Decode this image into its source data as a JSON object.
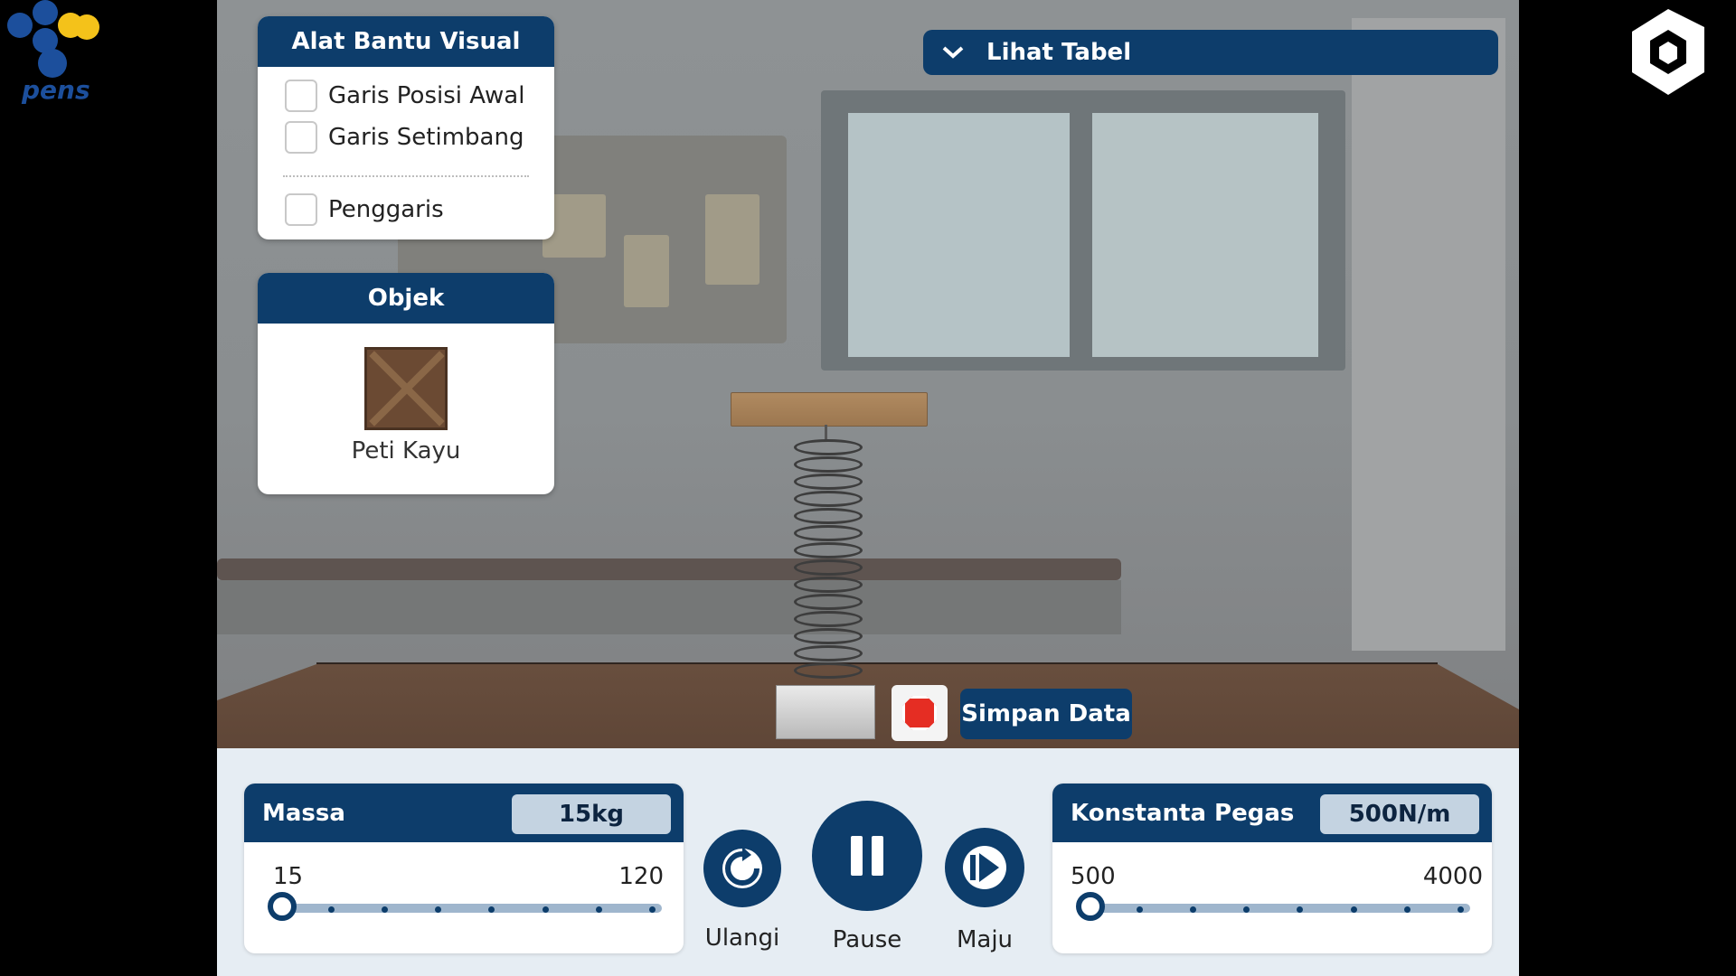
{
  "logos": {
    "left_text": "pens",
    "left_icon": "pens-logo-icon",
    "right_icon": "brand-logo-icon"
  },
  "colors": {
    "primary": "#0d3d6b",
    "slider_track": "#9fb6cd",
    "value_box": "#c4d3e1",
    "stop": "#e52d23"
  },
  "visual_aids": {
    "title": "Alat Bantu Visual",
    "options": [
      {
        "label": "Garis Posisi Awal",
        "checked": false
      },
      {
        "label": "Garis Setimbang",
        "checked": false
      },
      {
        "label": "Penggaris",
        "checked": false
      }
    ]
  },
  "object_panel": {
    "title": "Objek",
    "item_label": "Peti Kayu",
    "item_icon": "wooden-crate-icon"
  },
  "table_toggle": {
    "label": "Lihat Tabel",
    "icon": "chevron-down-icon"
  },
  "save_button": {
    "label": "Simpan Data"
  },
  "stop_button": {
    "icon": "stop-icon"
  },
  "mass": {
    "title": "Massa",
    "value": "15kg",
    "min": "15",
    "max": "120",
    "current": 15
  },
  "spring_constant": {
    "title": "Konstanta Pegas",
    "value": "500N/m",
    "min": "500",
    "max": "4000",
    "current": 500
  },
  "playback": {
    "reset_label": "Ulangi",
    "reset_icon": "reset-icon",
    "pause_label": "Pause",
    "pause_icon": "pause-icon",
    "step_label": "Maju",
    "step_icon": "step-forward-icon"
  }
}
